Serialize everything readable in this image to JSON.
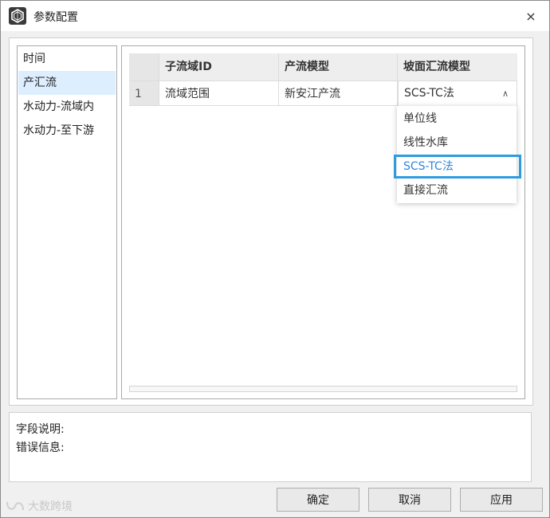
{
  "window": {
    "title": "参数配置",
    "close_symbol": "×"
  },
  "nav": {
    "items": [
      {
        "label": "时间"
      },
      {
        "label": "产汇流"
      },
      {
        "label": "水动力-流域内"
      },
      {
        "label": "水动力-至下游"
      }
    ],
    "active_index": 1
  },
  "table": {
    "headers": [
      "子流域ID",
      "产流模型",
      "坡面汇流模型"
    ],
    "rows": [
      {
        "index": "1",
        "subbasin_id": "流域范围",
        "runoff_model": "新安江产流",
        "routing_model": "SCS-TC法"
      }
    ]
  },
  "dropdown": {
    "options": [
      "单位线",
      "线性水库",
      "SCS-TC法",
      "直接汇流"
    ],
    "selected_index": 2
  },
  "info": {
    "field_desc_label": "字段说明:",
    "error_label": "错误信息:"
  },
  "buttons": {
    "ok": "确定",
    "cancel": "取消",
    "apply": "应用"
  },
  "watermark": {
    "text": "大数跨境"
  },
  "colors": {
    "accent": "#2d9ce0",
    "nav_active": "#ddeeff",
    "header_bg": "#eeeeee"
  }
}
